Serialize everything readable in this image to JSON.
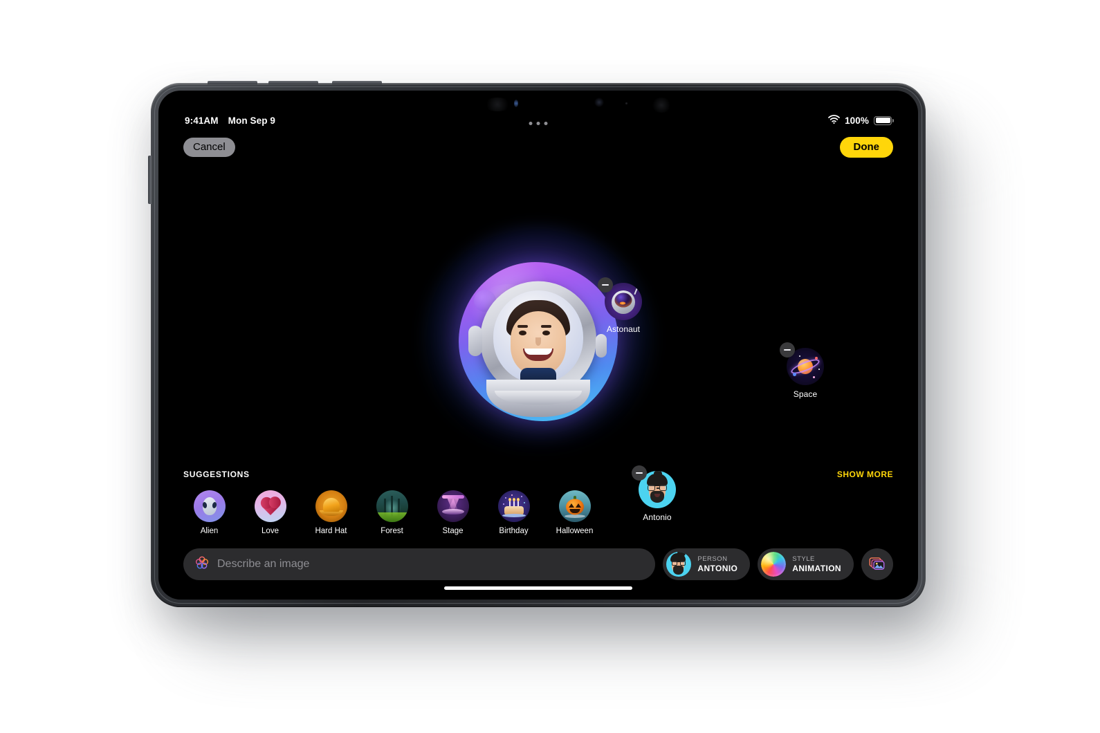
{
  "status_bar": {
    "time": "9:41AM",
    "date": "Mon Sep 9",
    "battery_percent": "100%",
    "wifi_icon": "wifi-icon",
    "battery_icon": "battery-full-icon"
  },
  "nav": {
    "cancel_label": "Cancel",
    "done_label": "Done"
  },
  "canvas": {
    "hero": {
      "name": "generated-astronaut-portrait",
      "alt": "Memoji person wearing an astronaut helmet"
    },
    "chips": [
      {
        "label": "Astonaut",
        "art": "astronaut-helmet-icon",
        "remove_icon": "minus-icon"
      },
      {
        "label": "Space",
        "art": "planet-saturn-icon",
        "remove_icon": "minus-icon"
      },
      {
        "label": "Antonio",
        "art": "memoji-antonio-icon",
        "remove_icon": "minus-icon"
      }
    ]
  },
  "suggestions": {
    "title": "SUGGESTIONS",
    "show_more_label": "SHOW MORE",
    "items": [
      {
        "label": "Alien",
        "art": "alien-icon"
      },
      {
        "label": "Love",
        "art": "heart-icon"
      },
      {
        "label": "Hard Hat",
        "art": "hard-hat-icon"
      },
      {
        "label": "Forest",
        "art": "forest-icon"
      },
      {
        "label": "Stage",
        "art": "stage-icon"
      },
      {
        "label": "Birthday",
        "art": "birthday-cake-icon"
      },
      {
        "label": "Halloween",
        "art": "jack-o-lantern-icon"
      }
    ]
  },
  "toolbar": {
    "prompt_placeholder": "Describe an image",
    "prompt_value": "",
    "playground_icon": "image-playground-icon",
    "person": {
      "kicker": "PERSON",
      "value": "ANTONIO",
      "avatar": "memoji-antonio-icon"
    },
    "style": {
      "kicker": "STYLE",
      "value": "ANIMATION",
      "swatch": "color-sphere-icon"
    },
    "photos_button_icon": "photo-stack-icon"
  },
  "colors": {
    "accent_yellow": "#ffd60a",
    "surface": "#2c2c2e",
    "screen_bg": "#000000",
    "muted_text": "#8e8e93"
  }
}
